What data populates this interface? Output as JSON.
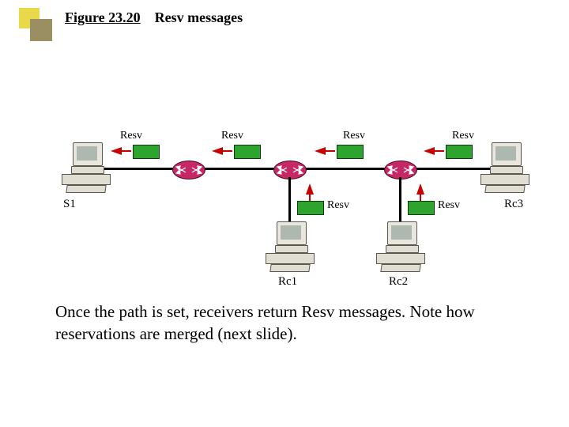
{
  "figure": {
    "number": "Figure 23.20",
    "caption": "Resv messages"
  },
  "hosts": {
    "s1": "S1",
    "rc1": "Rc1",
    "rc2": "Rc2",
    "rc3": "Rc3"
  },
  "resv_label": "Resv",
  "bottom_text": "Once the path is set, receivers return Resv messages.  Note how reservations are merged (next slide)."
}
